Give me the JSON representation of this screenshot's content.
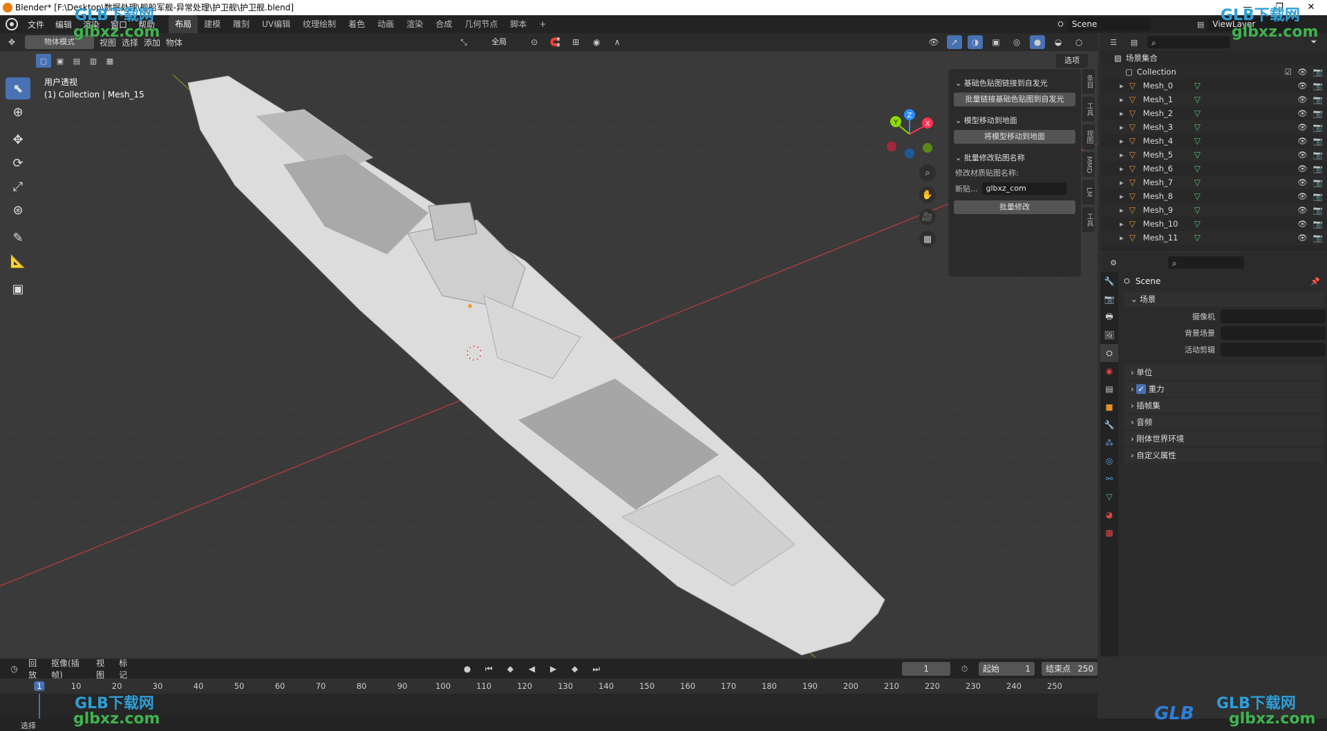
{
  "title": "Blender* [F:\\Desktop\\数据处理\\舰船军舰-异常处理\\护卫舰\\护卫舰.blend]",
  "menu": [
    "文件",
    "编辑",
    "渲染",
    "窗口",
    "帮助"
  ],
  "workspaces": [
    "布局",
    "建模",
    "雕刻",
    "UV编辑",
    "纹理绘制",
    "着色",
    "动画",
    "渲染",
    "合成",
    "几何节点",
    "脚本"
  ],
  "active_workspace": "布局",
  "plus": "+",
  "scene_name": "Scene",
  "view_layer": "ViewLayer",
  "viewport": {
    "mode": "物体模式",
    "header_menus": [
      "视图",
      "选择",
      "添加",
      "物体"
    ],
    "transform": "全局",
    "options_label": "选项",
    "view_name": "用户透视",
    "collection_info": "(1) Collection | Mesh_15"
  },
  "npanel": {
    "sections": [
      {
        "title": "基础色贴图链接到自发光",
        "button": "批量链接基础色贴图到自发光"
      },
      {
        "title": "模型移动到地面",
        "button": "将模型移动到地面"
      },
      {
        "title": "批量修改贴图名称",
        "label": "修改材质贴图名称:",
        "field_label": "新贴...",
        "field_value": "glbxz_com",
        "button": "批量修改"
      }
    ],
    "tabs": [
      "条目",
      "工具",
      "视图",
      "MMD",
      "LM",
      "工具"
    ]
  },
  "gizmo": {
    "x": "X",
    "y": "Y",
    "z": "Z"
  },
  "outliner": {
    "root": "场景集合",
    "collection": "Collection",
    "items": [
      "Mesh_0",
      "Mesh_1",
      "Mesh_2",
      "Mesh_3",
      "Mesh_4",
      "Mesh_5",
      "Mesh_6",
      "Mesh_7",
      "Mesh_8",
      "Mesh_9",
      "Mesh_10",
      "Mesh_11"
    ]
  },
  "properties": {
    "header": "Scene",
    "section_scene": "场景",
    "rows": [
      {
        "label": "摄像机"
      },
      {
        "label": "背景场景"
      },
      {
        "label": "活动剪辑"
      }
    ],
    "panels": [
      "单位",
      "重力",
      "插帧集",
      "音频",
      "刚体世界环境",
      "自定义属性"
    ]
  },
  "timeline": {
    "menus": [
      "回放",
      "抠像(插帧)",
      "视图",
      "标记"
    ],
    "current_frame": "1",
    "start_label": "起始",
    "start": "1",
    "end_label": "结束点",
    "end": "250",
    "ticks": [
      "1",
      "10",
      "20",
      "30",
      "40",
      "50",
      "60",
      "70",
      "80",
      "90",
      "100",
      "110",
      "120",
      "130",
      "140",
      "150",
      "160",
      "170",
      "180",
      "190",
      "200",
      "210",
      "220",
      "230",
      "240",
      "250"
    ]
  },
  "status": {
    "left": "选择"
  },
  "watermark": {
    "brand": "GLB下载网",
    "url": "glbxz.com",
    "mark": "GLB"
  },
  "colors": {
    "accent": "#4772b3",
    "x_axis": "#ff3352",
    "y_axis": "#8bdc00",
    "z_axis": "#2890ff",
    "outliner_mesh": "#e7902a",
    "data_green": "#5ac870"
  }
}
